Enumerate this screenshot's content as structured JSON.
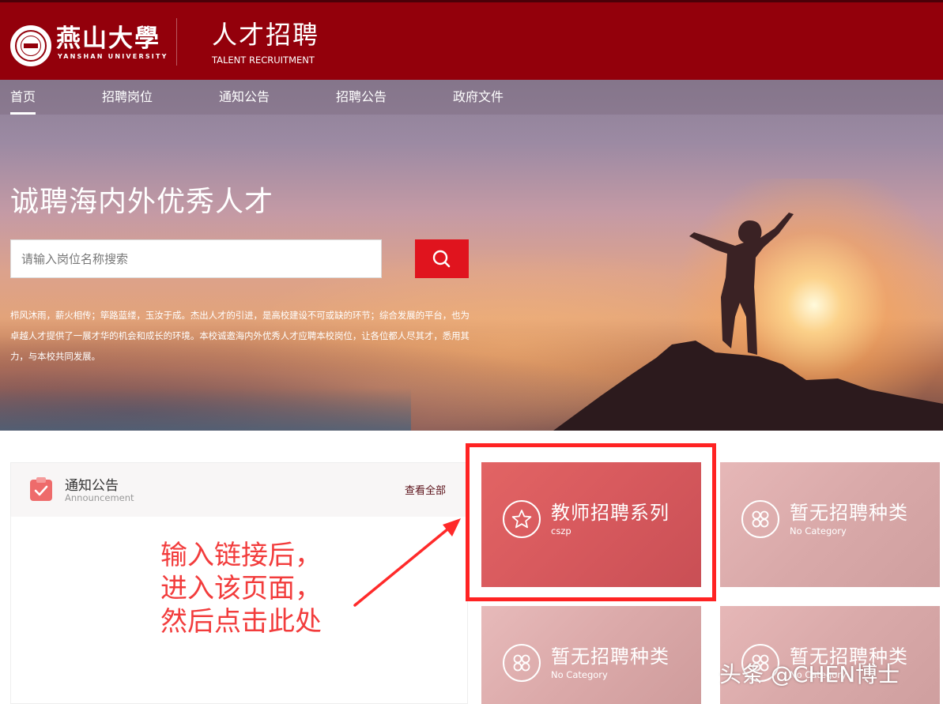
{
  "header": {
    "logo_cn": "燕山大學",
    "logo_en": "YANSHAN UNIVERSITY",
    "title": "人才招聘",
    "subtitle": "TALENT RECRUITMENT"
  },
  "nav": {
    "items": [
      {
        "label": "首页",
        "active": true
      },
      {
        "label": "招聘岗位"
      },
      {
        "label": "通知公告"
      },
      {
        "label": "招聘公告"
      },
      {
        "label": "政府文件"
      }
    ]
  },
  "hero": {
    "title": "诚聘海内外优秀人才",
    "search": {
      "placeholder": "请输入岗位名称搜索"
    },
    "description": "栉风沐雨，薪火相传；筚路蓝缕，玉汝于成。杰出人才的引进，是高校建设不可或缺的环节；综合发展的平台，也为卓越人才提供了一展才华的机会和成长的环境。本校诚邀海内外优秀人才应聘本校岗位，让各位都人尽其才，悉用其力，与本校共同发展。"
  },
  "announcement": {
    "title": "通知公告",
    "subtitle": "Announcement",
    "more_label": "查看全部"
  },
  "categories": [
    {
      "title": "教师招聘系列",
      "code": "cszp",
      "icon": "star-icon"
    },
    {
      "title": "暂无招聘种类",
      "code": "No Category",
      "icon": "clover-icon"
    },
    {
      "title": "暂无招聘种类",
      "code": "No Category",
      "icon": "clover-icon"
    },
    {
      "title": "暂无招聘种类",
      "code": "No Category",
      "icon": "clover-icon"
    }
  ],
  "annotation": {
    "lines": [
      "输入链接后，",
      "进入该页面，",
      "然后点击此处"
    ]
  },
  "watermark": "头条 @CHEN博士",
  "colors": {
    "brand": "#93000b",
    "search_button": "#e0141e",
    "annotation": "#f23c3c"
  }
}
